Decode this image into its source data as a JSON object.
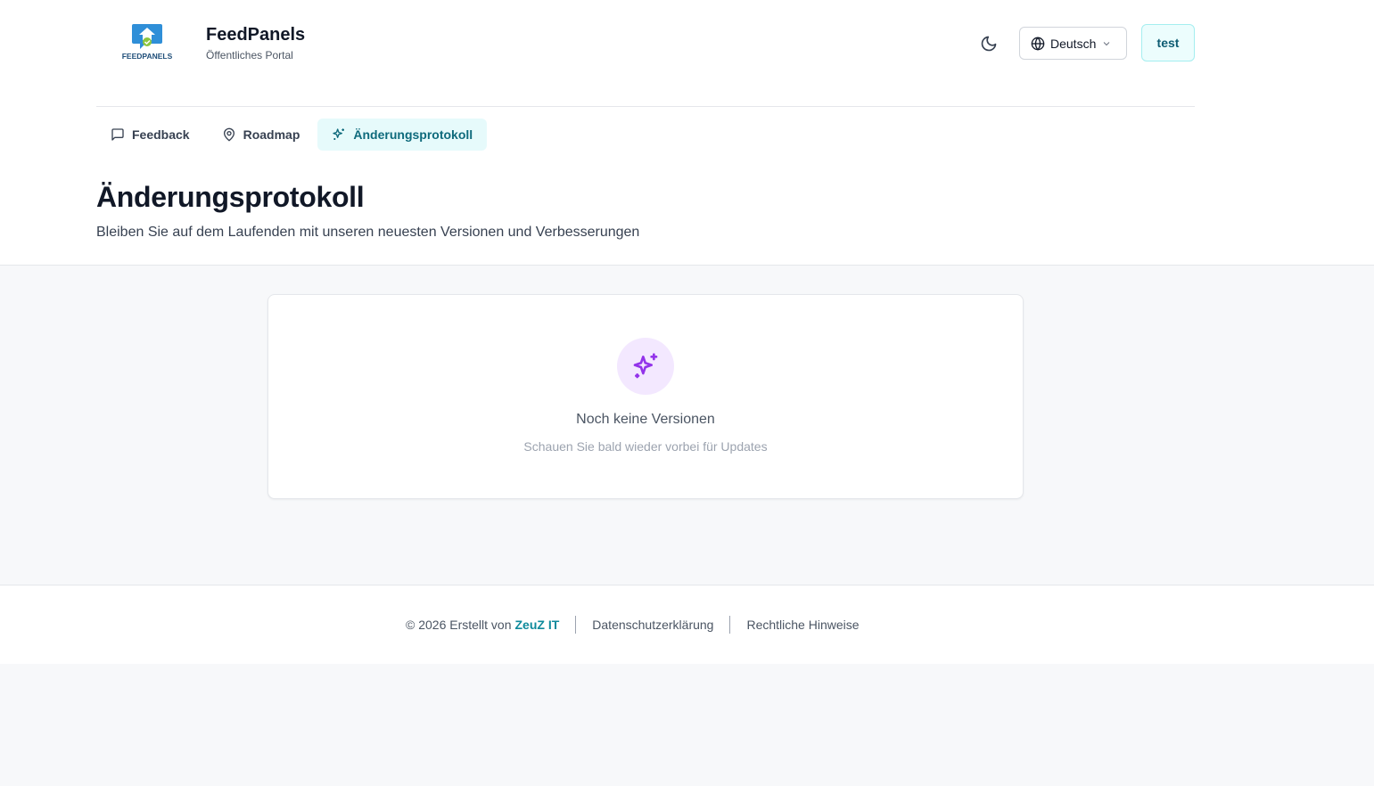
{
  "header": {
    "brand_name": "FeedPanels",
    "brand_subtitle": "Öffentliches Portal",
    "logo_text": "FEEDPANELS",
    "language_label": "Deutsch",
    "user_label": "test"
  },
  "nav": {
    "items": [
      {
        "label": "Feedback",
        "icon": "message-square-icon"
      },
      {
        "label": "Roadmap",
        "icon": "map-pin-icon"
      },
      {
        "label": "Änderungsprotokoll",
        "icon": "sparkles-icon",
        "active": true
      }
    ]
  },
  "page": {
    "title": "Änderungsprotokoll",
    "subtitle": "Bleiben Sie auf dem Laufenden mit unseren neuesten Versionen und Verbesserungen"
  },
  "empty_state": {
    "title": "Noch keine Versionen",
    "subtitle": "Schauen Sie bald wieder vorbei für Updates",
    "icon": "sparkles-icon"
  },
  "footer": {
    "copyright": "© 2026 Erstellt von",
    "brand": "ZeuZ IT",
    "privacy": "Datenschutzerklärung",
    "legal": "Rechtliche Hinweise"
  },
  "colors": {
    "accent": "#0e8a9c",
    "active_nav_bg": "#e6fafb",
    "icon_purple": "#9333ea",
    "icon_bg": "#f3e8ff"
  }
}
